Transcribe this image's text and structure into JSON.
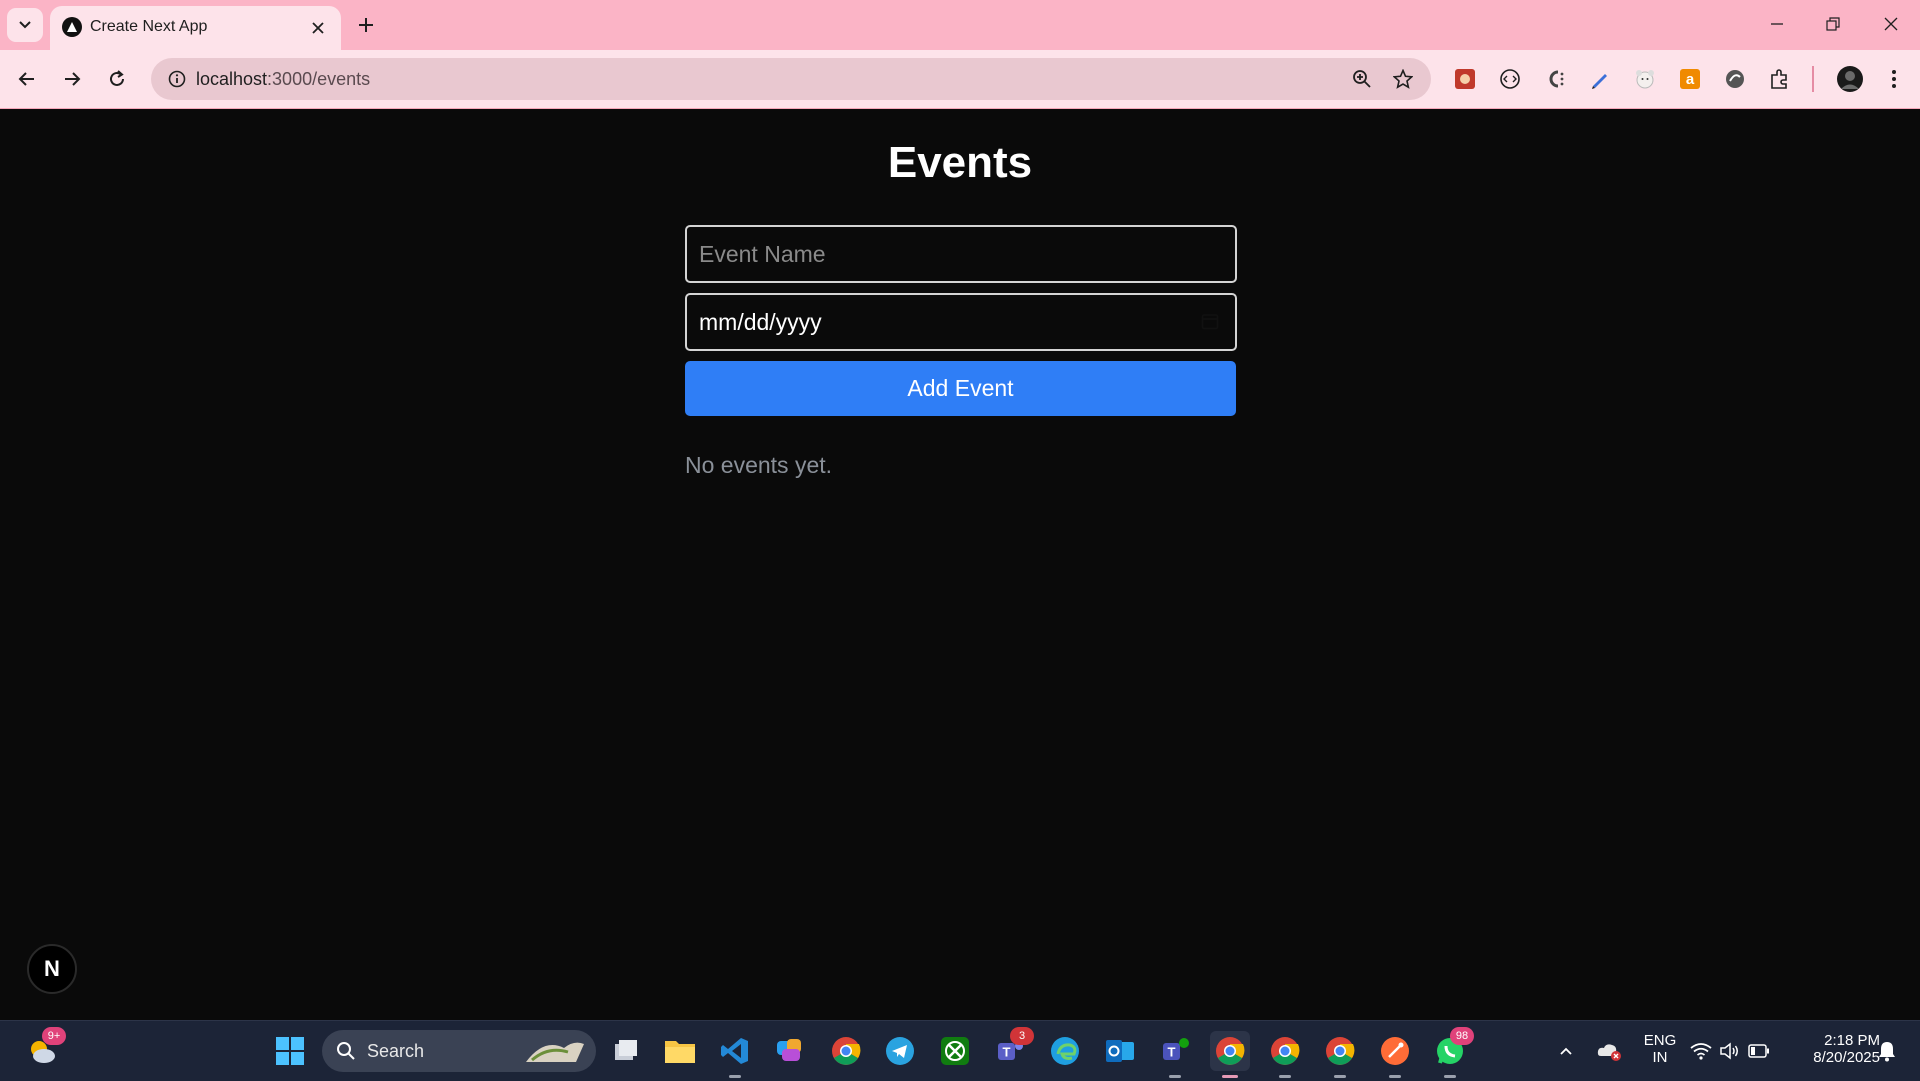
{
  "browser": {
    "tab_title": "Create Next App",
    "url_host": "localhost",
    "url_path": ":3000/events",
    "extensions": [
      "video-extension-icon",
      "code-extension-icon",
      "css-extension-icon",
      "pen-extension-icon",
      "bear-extension-icon",
      "amazon-extension-icon",
      "vpn-extension-icon",
      "puzzle-extensions-icon"
    ]
  },
  "page": {
    "title": "Events",
    "event_name_placeholder": "Event Name",
    "date_placeholder": "mm/dd/yyyy",
    "add_button": "Add Event",
    "empty_message": "No events yet.",
    "next_badge": "N"
  },
  "taskbar": {
    "weather_badge": "9+",
    "search_label": "Search",
    "teams_badge": "3",
    "whatsapp_badge": "98",
    "lang_top": "ENG",
    "lang_bottom": "IN",
    "time": "2:18 PM",
    "date": "8/20/2025"
  },
  "colors": {
    "accent": "#2f7ef6",
    "tabbar": "#fbb4c6",
    "page_bg": "#0a0a0a"
  }
}
